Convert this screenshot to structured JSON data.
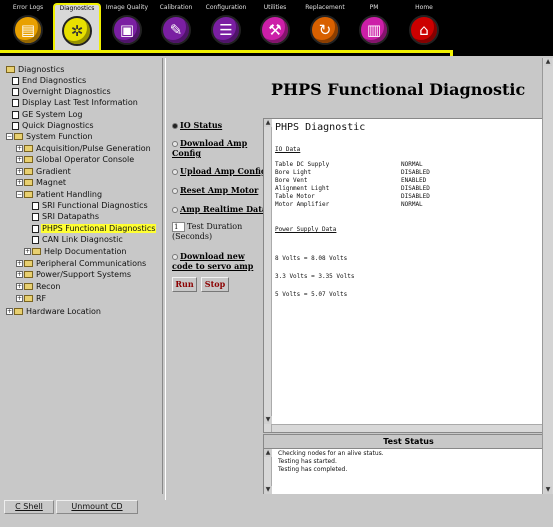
{
  "toolbar": {
    "accent": "#f0f000",
    "buttons": [
      {
        "label": "Error Logs",
        "icon": "error-logs-icon",
        "color": "#e8a000"
      },
      {
        "label": "Diagnostics",
        "icon": "diagnostics-icon",
        "color": "#e8e000"
      },
      {
        "label": "Image Quality",
        "icon": "image-quality-icon",
        "color": "#7a1fa2"
      },
      {
        "label": "Calibration",
        "icon": "calibration-icon",
        "color": "#7a1fa2"
      },
      {
        "label": "Configuration",
        "icon": "configuration-icon",
        "color": "#7a1fa2"
      },
      {
        "label": "Utilities",
        "icon": "utilities-icon",
        "color": "#cc1fa8"
      },
      {
        "label": "Replacement",
        "icon": "replacement-icon",
        "color": "#d86000"
      },
      {
        "label": "PM",
        "icon": "pm-icon",
        "color": "#cc1fa8"
      },
      {
        "label": "Home",
        "icon": "home-icon",
        "color": "#cc0000"
      }
    ]
  },
  "tree": {
    "root": "Diagnostics",
    "items": [
      {
        "label": "End Diagnostics"
      },
      {
        "label": "Overnight Diagnostics"
      },
      {
        "label": "Display Last Test Information"
      },
      {
        "label": "GE System Log"
      },
      {
        "label": "Quick Diagnostics"
      },
      {
        "label": "System Function"
      },
      {
        "label": "Acquisition/Pulse Generation"
      },
      {
        "label": "Global Operator Console"
      },
      {
        "label": "Gradient"
      },
      {
        "label": "Magnet"
      },
      {
        "label": "Patient Handling"
      },
      {
        "label": "SRI Functional Diagnostics"
      },
      {
        "label": "SRI Datapaths"
      },
      {
        "label": "PHPS Functional Diagnostics"
      },
      {
        "label": "CAN Link Diagnostic"
      },
      {
        "label": "Help Documentation"
      },
      {
        "label": "Peripheral Communications"
      },
      {
        "label": "Power/Support Systems"
      },
      {
        "label": "Recon"
      },
      {
        "label": "RF"
      },
      {
        "label": "Hardware Location"
      }
    ]
  },
  "bottom_buttons": {
    "shell": "C Shell",
    "unmount": "Unmount CD"
  },
  "main": {
    "title": "PHPS Functional Diagnostic",
    "options": [
      {
        "label": "IO Status",
        "selected": true
      },
      {
        "label": "Download Amp Config",
        "selected": false
      },
      {
        "label": "Upload Amp Config",
        "selected": false
      },
      {
        "label": "Reset Amp Motor",
        "selected": false
      },
      {
        "label": "Amp Realtime Data",
        "selected": false
      },
      {
        "label": "Download new code to servo amp",
        "selected": false
      }
    ],
    "duration": {
      "value": "1",
      "label": "Test Duration (Seconds)"
    },
    "run_label": "Run",
    "stop_label": "Stop",
    "run_color": "#8b0000"
  },
  "output": {
    "header": "PHPS Diagnostic",
    "io_title": "IO Data",
    "io_rows": [
      {
        "name": "Table DC Supply",
        "value": "NORMAL"
      },
      {
        "name": "Bore Light",
        "value": "DISABLED"
      },
      {
        "name": "Bore Vent",
        "value": "ENABLED"
      },
      {
        "name": "Alignment Light",
        "value": "DISABLED"
      },
      {
        "name": "Table Motor",
        "value": "DISABLED"
      },
      {
        "name": "Motor Amplifier",
        "value": "NORMAL"
      }
    ],
    "power_title": "Power Supply Data",
    "power_rows": [
      "8 Volts = 8.08 Volts",
      "3.3 Volts = 3.35 Volts",
      "5 Volts = 5.07 Volts"
    ]
  },
  "status": {
    "title": "Test Status",
    "lines": [
      "Checking nodes for an alive status.",
      "Testing has started.",
      "Testing has completed."
    ]
  }
}
